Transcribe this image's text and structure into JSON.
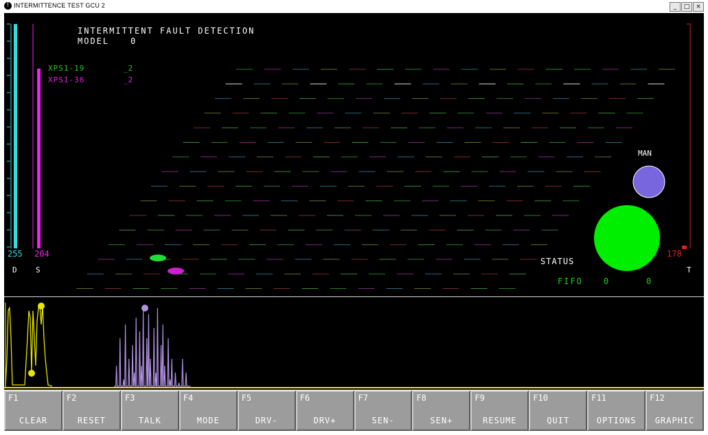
{
  "window": {
    "title": "INTERMITTENCE TEST    GCU    2",
    "icon": "app-icon",
    "controls": [
      "_",
      "□",
      "×"
    ]
  },
  "main": {
    "heading": "INTERMITTENT FAULT DETECTION",
    "model_label": "MODEL",
    "model_value": "0",
    "channels": [
      {
        "name": "XPS1-19",
        "value": "_2",
        "color": "#22cc22"
      },
      {
        "name": "XPS1-36",
        "value": "_2",
        "color": "#dd22dd"
      }
    ],
    "d_value": "255",
    "s_value": "204",
    "d_label": "D",
    "s_label": "S",
    "t_value": "178",
    "t_label": "T",
    "man_label": "MAN",
    "status_label": "STATUS",
    "fifo_label": "FIFO",
    "fifo_values": [
      "0",
      "0"
    ],
    "levels": {
      "d": 1.0,
      "s": 0.8,
      "t": 0.7
    },
    "colors": {
      "d": "#33dddd",
      "s": "#ee22ee",
      "t": "#dd2222",
      "man": "#7766dd",
      "status": "#00ee00",
      "fifo": "#22cc22"
    }
  },
  "function_keys": [
    {
      "key": "F1",
      "label": "CLEAR"
    },
    {
      "key": "F2",
      "label": "RESET"
    },
    {
      "key": "F3",
      "label": "TALK"
    },
    {
      "key": "F4",
      "label": "MODE"
    },
    {
      "key": "F5",
      "label": "DRV-"
    },
    {
      "key": "F6",
      "label": "DRV+"
    },
    {
      "key": "F7",
      "label": "SEN-"
    },
    {
      "key": "F8",
      "label": "SEN+"
    },
    {
      "key": "F9",
      "label": "RESUME"
    },
    {
      "key": "F10",
      "label": "QUIT"
    },
    {
      "key": "F11",
      "label": "OPTIONS"
    },
    {
      "key": "F12",
      "label": "GRAPHIC"
    }
  ]
}
